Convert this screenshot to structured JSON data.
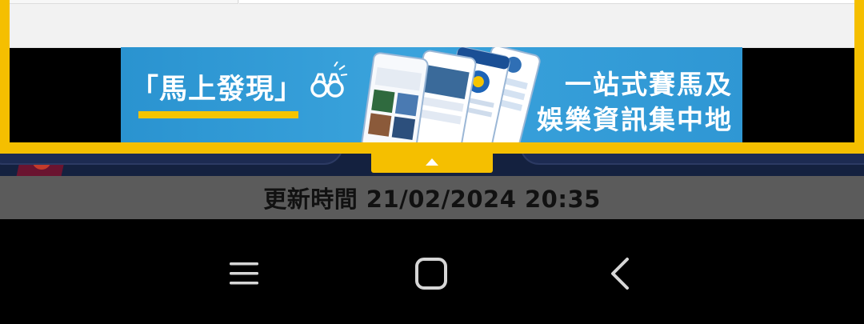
{
  "ad": {
    "banner_left_text": "「馬上發現」",
    "banner_right_line1": "一站式賽馬及",
    "banner_right_line2": "娛樂資訊集中地",
    "colors": {
      "frame": "#f5bf00",
      "banner": "#2f97d4",
      "underline": "#f5c400"
    }
  },
  "collapse": {
    "icon": "triangle-up-icon"
  },
  "status": {
    "update_time": "更新時間 21/02/2024 20:35"
  },
  "navbar": {
    "recents_icon": "recents-icon",
    "home_icon": "home-icon",
    "back_icon": "back-icon"
  }
}
